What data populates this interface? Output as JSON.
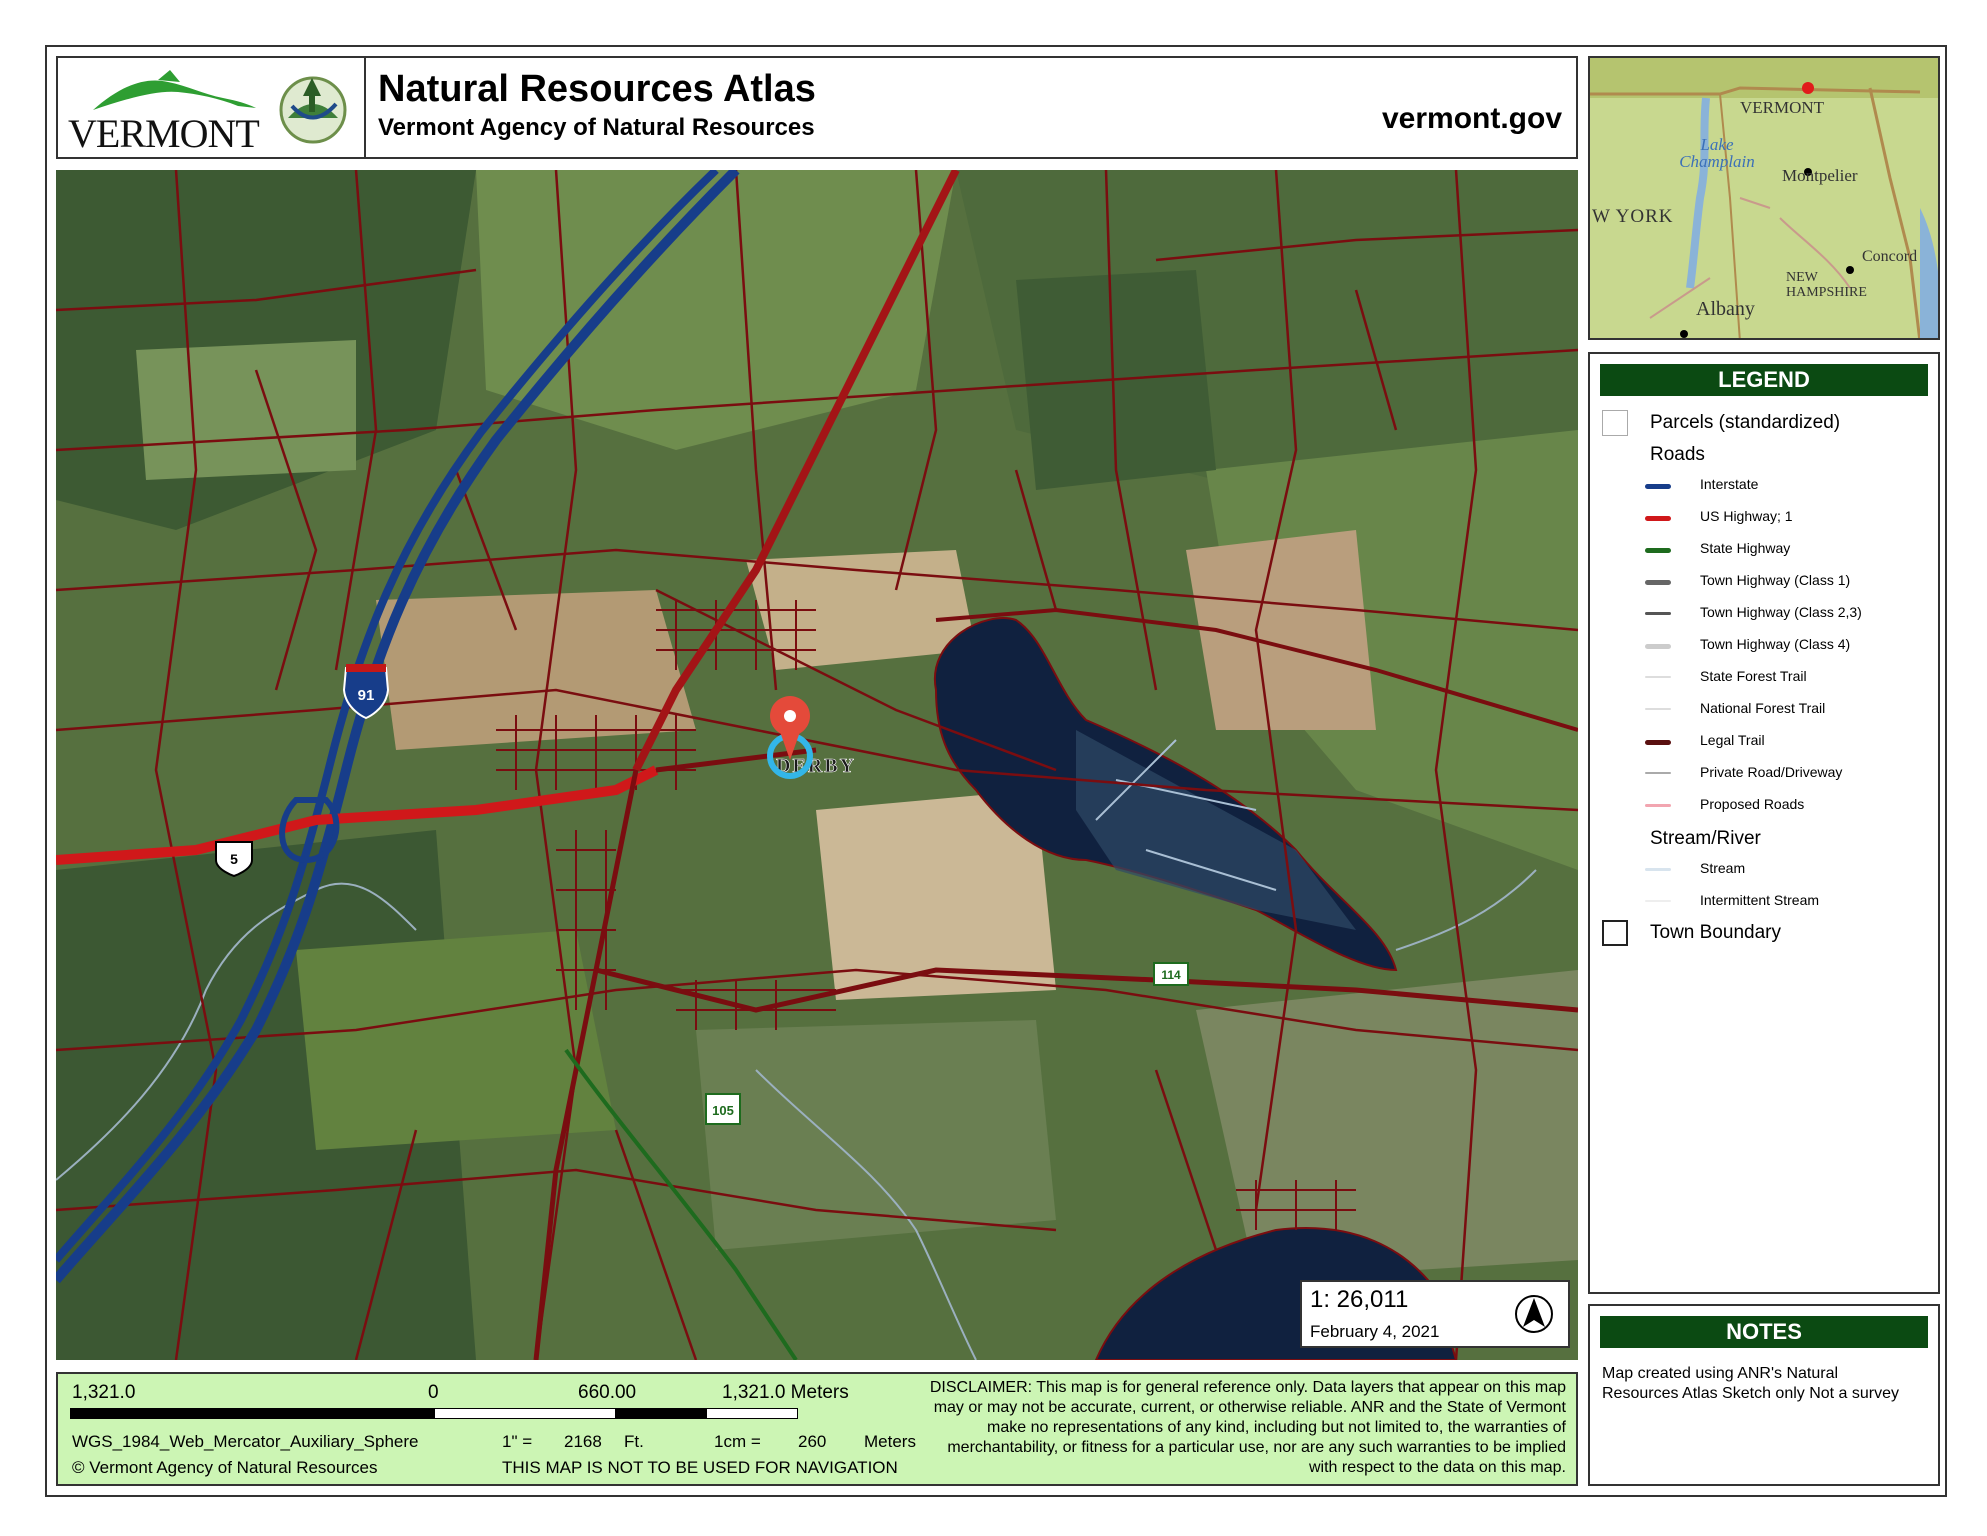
{
  "header": {
    "logo_text": "VERMONT",
    "title": "Natural Resources Atlas",
    "subtitle": "Vermont Agency of Natural Resources",
    "site": "vermont.gov"
  },
  "map": {
    "labels": {
      "interstate_shield": "91",
      "us_shield": "5",
      "state_shield_a": "114",
      "state_shield_b": "105",
      "town_label": "DERBY"
    },
    "scale_ratio": "1:  26,011",
    "date": "February 4, 2021",
    "colors": {
      "parcel": "#7a0d10",
      "interstate": "#173d8a",
      "us_highway": "#d0181a",
      "water": "#10213f"
    }
  },
  "inset": {
    "labels": [
      "VERMONT",
      "Lake Champlain",
      "Montpelier",
      "W YORK",
      "Concord",
      "NEW HAMPSHIRE",
      "Albany"
    ]
  },
  "legend": {
    "title": "LEGEND",
    "parcels": "Parcels (standardized)",
    "roads_heading": "Roads",
    "roads": [
      {
        "label": "Interstate",
        "color": "#173d8a"
      },
      {
        "label": "US Highway; 1",
        "color": "#d0181a"
      },
      {
        "label": "State Highway",
        "color": "#1e6b1e"
      },
      {
        "label": "Town Highway (Class 1)",
        "color": "#666666"
      },
      {
        "label": "Town Highway (Class 2,3)",
        "color": "#555555"
      },
      {
        "label": "Town Highway (Class 4)",
        "color": "#cccccc"
      },
      {
        "label": "State Forest Trail",
        "color": "#dddddd"
      },
      {
        "label": "National Forest Trail",
        "color": "#dddddd"
      },
      {
        "label": "Legal Trail",
        "color": "#5a1010"
      },
      {
        "label": "Private Road/Driveway",
        "color": "#aaaaaa"
      },
      {
        "label": "Proposed Roads",
        "color": "#f2a5b0"
      }
    ],
    "stream_heading": "Stream/River",
    "streams": [
      {
        "label": "Stream",
        "color": "#d8e4ee"
      },
      {
        "label": "Intermittent Stream",
        "color": "#eeeeee"
      }
    ],
    "town_boundary": "Town Boundary"
  },
  "notes": {
    "title": "NOTES",
    "text": "Map created using ANR's Natural Resources Atlas  Sketch only  Not a survey"
  },
  "footer": {
    "scale_left": "1,321.0",
    "scale_zero": "0",
    "scale_mid": "660.00",
    "scale_right": "1,321.0 Meters",
    "projection": "WGS_1984_Web_Mercator_Auxiliary_Sphere",
    "inch_label": "1\" =",
    "inch_value": "2168",
    "inch_unit": "Ft.",
    "cm_label": "1cm =",
    "cm_value": "260",
    "cm_unit": "Meters",
    "copyright": "© Vermont Agency of Natural Resources",
    "navigation": "THIS MAP IS NOT TO BE USED FOR NAVIGATION",
    "disclaimer": "DISCLAIMER: This map is for general reference only. Data layers that appear on this map may or may not be accurate, current, or otherwise reliable. ANR and the State of Vermont make no representations of any kind, including but not limited to, the warranties of merchantability, or fitness for a particular use, nor are any such warranties to be implied with respect to the data on this map."
  }
}
